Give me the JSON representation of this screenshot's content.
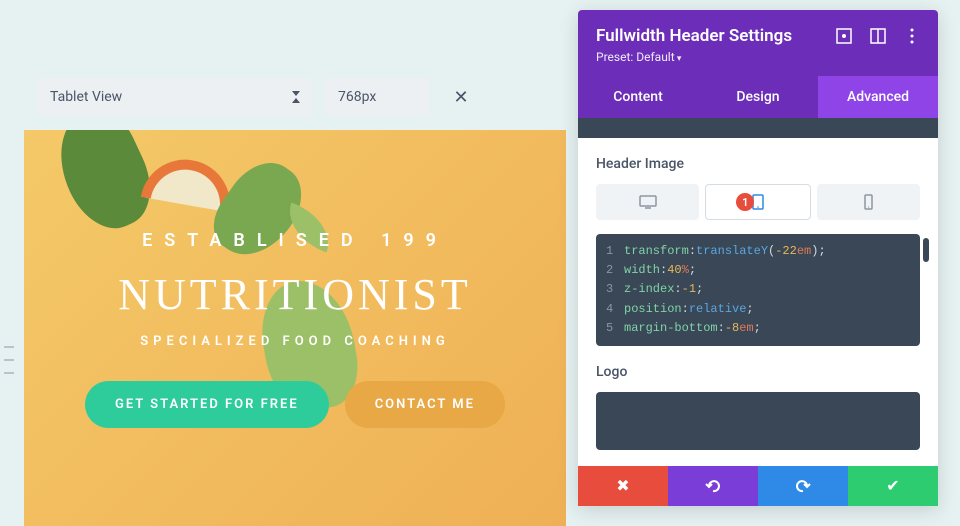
{
  "topbar": {
    "view_label": "Tablet View",
    "width_value": "768px"
  },
  "preview": {
    "established": "ESTABLISED 199",
    "brand": "NUTRITIONIST",
    "tagline": "SPECIALIZED FOOD COACHING",
    "cta_primary": "GET STARTED FOR FREE",
    "cta_secondary": "CONTACT ME"
  },
  "panel": {
    "title": "Fullwidth Header Settings",
    "preset": "Preset: Default",
    "tabs": {
      "content": "Content",
      "design": "Design",
      "advanced": "Advanced"
    },
    "section_header_image": "Header Image",
    "device_badge": "1",
    "code": [
      {
        "n": "1",
        "prop": "transform",
        "fn": "translateY",
        "val": "-22",
        "unit": "em"
      },
      {
        "n": "2",
        "prop": "width",
        "val": "40",
        "unit": "%"
      },
      {
        "n": "3",
        "prop": "z-index",
        "val": "-1"
      },
      {
        "n": "4",
        "prop": "position",
        "val_kw": "relative"
      },
      {
        "n": "5",
        "prop": "margin-bottom",
        "val": "-8",
        "unit": "em"
      }
    ],
    "section_logo": "Logo"
  }
}
